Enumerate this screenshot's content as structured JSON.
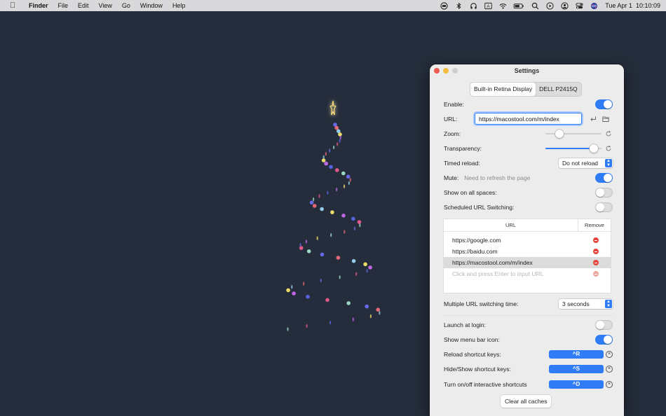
{
  "menubar": {
    "app_name": "Finder",
    "items": [
      "File",
      "Edit",
      "View",
      "Go",
      "Window",
      "Help"
    ],
    "status_icons": [
      "globe-icon",
      "bluetooth-icon",
      "headphones-icon",
      "input-source-icon",
      "wifi-icon",
      "battery-icon",
      "search-icon",
      "play-icon",
      "user-icon",
      "control-center-icon",
      "siri-icon"
    ],
    "input_source_label": "A",
    "date": "Tue Apr 1",
    "time": "10:10:09"
  },
  "window": {
    "title": "Settings",
    "display_tabs": [
      "Built-in Retina Display",
      "DELL P2415Q"
    ],
    "active_tab": 0,
    "enable_label": "Enable:",
    "enable_on": true,
    "url_label": "URL:",
    "url_value": "https://macostool.com/m/index",
    "zoom_label": "Zoom:",
    "zoom_level": 0.2,
    "transparency_label": "Transparency:",
    "transparency_level": 0.92,
    "timed_reload_label": "Timed reload:",
    "timed_reload_value": "Do not reload",
    "mute_label": "Mute:",
    "mute_hint": "Need to refresh the page",
    "mute_on": true,
    "show_all_spaces_label": "Show on all spaces:",
    "show_all_spaces_on": false,
    "scheduled_label": "Scheduled URL Switching:",
    "scheduled_on": false,
    "table": {
      "col_url": "URL",
      "col_remove": "Remove",
      "rows": [
        "https://google.com",
        "https://baidu.com",
        "https://macostool.com/m/index"
      ],
      "selected_row": 2,
      "placeholder": "Click and press Enter to input URL"
    },
    "switch_time_label": "Multiple URL switching time:",
    "switch_time_value": "3 seconds",
    "launch_label": "Launch at login:",
    "launch_on": false,
    "menubar_icon_label": "Show menu bar icon:",
    "menubar_icon_on": true,
    "reload_keys_label": "Reload shortcut keys:",
    "reload_keys": "^R",
    "hide_keys_label": "Hide/Show shortcut keys:",
    "hide_keys": "^S",
    "interactive_label": "Turn on/off interactive shortcuts",
    "interactive_keys": "^D",
    "clear_caches_label": "Clear all caches"
  },
  "colors": {
    "desktop": "#252d3c",
    "accent": "#2f7cf6",
    "remove": "#e4443b",
    "star": "#f2d77a"
  }
}
